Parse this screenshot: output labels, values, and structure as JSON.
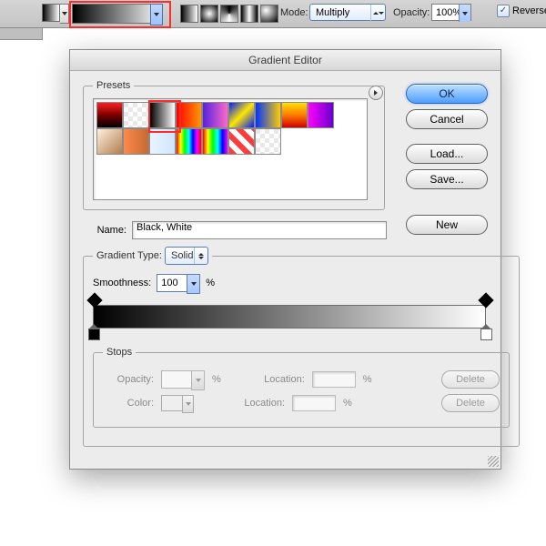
{
  "toolbar": {
    "mode_label": "Mode:",
    "mode_value": "Multiply",
    "opacity_label": "Opacity:",
    "opacity_value": "100%",
    "reverse_label": "Reverse",
    "reverse_checked": true,
    "gradient_types": [
      "linear",
      "radial",
      "angle",
      "reflected",
      "diamond"
    ]
  },
  "dialog": {
    "title": "Gradient Editor",
    "presets_label": "Presets",
    "presets": [
      {
        "css": "linear-gradient(to bottom,#ff2020,#7a0000,#000)"
      },
      {
        "css": "repeating-conic-gradient(#fff 0 25%,#e8e8e8 0 50%) 0 0/10px 10px"
      },
      {
        "css": "linear-gradient(to right,#000,#fff)"
      },
      {
        "css": "linear-gradient(to right,#ff0000,#ff9900)"
      },
      {
        "css": "linear-gradient(to right,#5522dd,#ff66cc)"
      },
      {
        "css": "linear-gradient(135deg,#001aff,#ffe600,#001aff)"
      },
      {
        "css": "linear-gradient(to right,#0033ff,#ffcc00)"
      },
      {
        "css": "linear-gradient(to bottom,#ffe000,#ff7a00,#cc0000)"
      },
      {
        "css": "linear-gradient(to right,#ff00ff,#6600cc)"
      },
      {
        "css": "linear-gradient(135deg,#fff0e0,#b37d4e)"
      },
      {
        "css": "linear-gradient(to right,#ff8a4a,#c46a34)"
      },
      {
        "css": "linear-gradient(to right,#eaf4ff,#cfe5ff)"
      },
      {
        "css": "linear-gradient(to right,#ff0000,#ffff00,#00ff00,#00ffff,#0000ff,#ff00ff,#ff0000)"
      },
      {
        "css": "linear-gradient(to right,#ff0000,#ffff00,#00ff00,#00ffff,#0000ff,#ff00ff)"
      },
      {
        "css": "repeating-linear-gradient(45deg,#ff3a3a 0 6px,#fff 6px 12px)"
      },
      {
        "css": "repeating-conic-gradient(#fff 0 25%,#e8e8e8 0 50%) 0 0/10px 10px"
      }
    ],
    "highlight_index": 2,
    "buttons": {
      "ok": "OK",
      "cancel": "Cancel",
      "load": "Load...",
      "save": "Save...",
      "new": "New"
    },
    "name_label": "Name:",
    "name_value": "Black, White",
    "type_label": "Gradient Type:",
    "type_value": "Solid",
    "smooth_label": "Smoothness:",
    "smooth_value": "100",
    "percent": "%",
    "gradient_bar_css": "linear-gradient(to right,#000,#fff)",
    "stops_label": "Stops",
    "stops": {
      "opacity_label": "Opacity:",
      "opacity_value": "",
      "color_label": "Color:",
      "location_label": "Location:",
      "location_value": "",
      "delete": "Delete"
    }
  }
}
